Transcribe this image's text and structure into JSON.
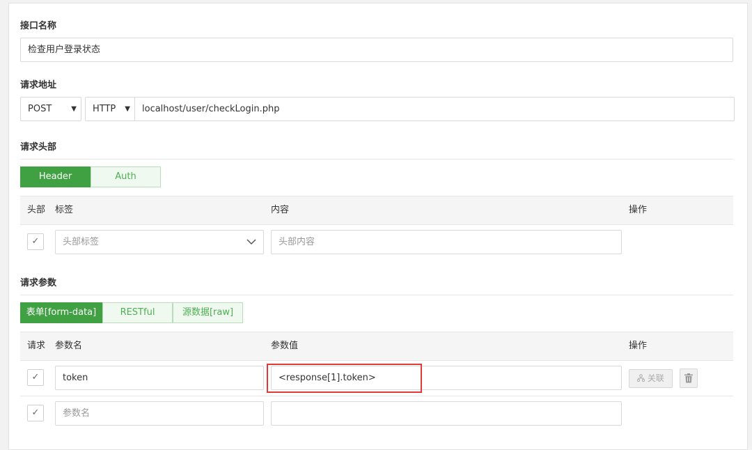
{
  "api_name": {
    "label": "接口名称",
    "value": "检查用户登录状态"
  },
  "request_url": {
    "label": "请求地址",
    "method": "POST",
    "protocol": "HTTP",
    "url": "localhost/user/checkLogin.php"
  },
  "request_headers": {
    "label": "请求头部",
    "tabs": [
      {
        "label": "Header",
        "active": true
      },
      {
        "label": "Auth",
        "active": false
      }
    ],
    "columns": {
      "enabled": "头部",
      "tag": "标签",
      "content": "内容",
      "action": "操作"
    },
    "row": {
      "tag_placeholder": "头部标签",
      "content_placeholder": "头部内容",
      "checked_icon": "check-icon"
    }
  },
  "request_params": {
    "label": "请求参数",
    "tabs": [
      {
        "label": "表单[form-data]",
        "active": true
      },
      {
        "label": "RESTful",
        "active": false
      },
      {
        "label": "源数据[raw]",
        "active": false
      }
    ],
    "columns": {
      "enabled": "请求",
      "name": "参数名",
      "value": "参数值",
      "action": "操作"
    },
    "rows": [
      {
        "name": "token",
        "value": "<response[1].token>",
        "link_label": "关联"
      },
      {
        "name_placeholder": "参数名",
        "value": ""
      }
    ]
  },
  "colors": {
    "accent_green": "#3fa142",
    "highlight_red": "#e53935"
  }
}
